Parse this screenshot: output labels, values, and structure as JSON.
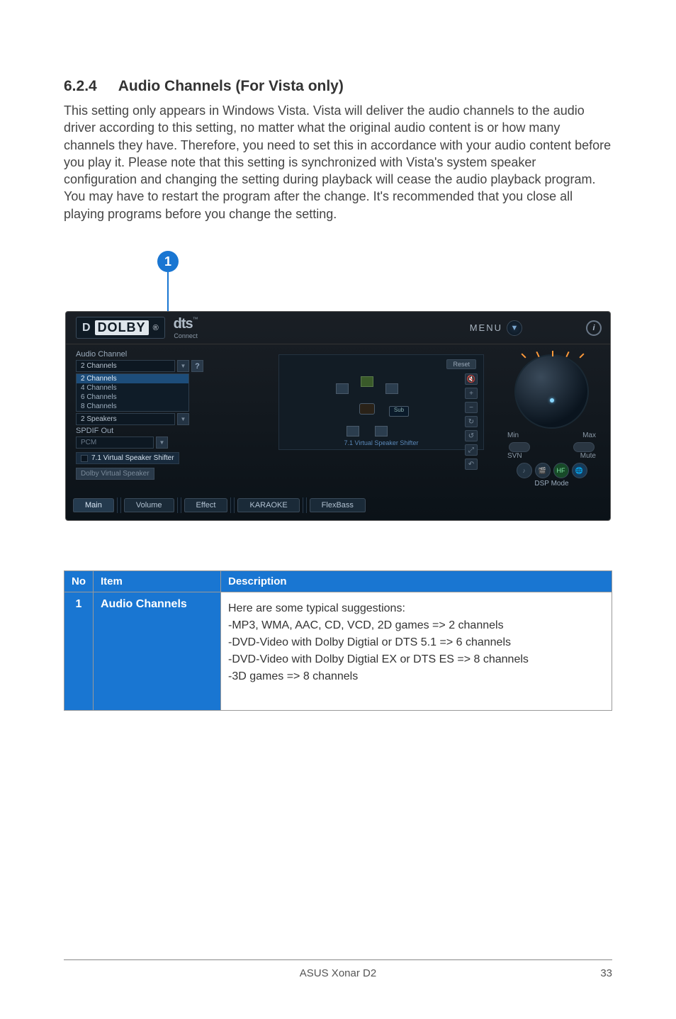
{
  "heading": {
    "number": "6.2.4",
    "title": "Audio Channels (For Vista only)"
  },
  "body": "This setting only appears in Windows Vista. Vista will deliver the audio channels to the audio driver according to this setting, no matter what the original audio content is or how many channels they have. Therefore, you need to set this in accordance with your audio content before you play it. Please note that this setting is synchronized with Vista's system speaker configuration and changing the setting during playback will cease the audio playback program. You may have to restart the program after the change. It's recommended that you close all playing programs before you change the setting.",
  "callout": {
    "number": "1"
  },
  "shot": {
    "logos": {
      "dolby_small": "D",
      "dolby_text": "DOLBY",
      "reg": "®",
      "dts": "dts",
      "dts_tm": "™",
      "connect": "Connect"
    },
    "menu": {
      "label": "MENU",
      "arrow": "▼"
    },
    "info": "i",
    "audio_channel_label": "Audio Channel",
    "audio_channel_value": "2 Channels",
    "audio_channel_options": [
      "2 Channels",
      "4 Channels",
      "6 Channels",
      "8 Channels"
    ],
    "analog_out_value": "2 Speakers",
    "spdif_label": "SPDIF Out",
    "spdif_value": "PCM",
    "vss_label": "7.1 Virtual Speaker Shifter",
    "dvs_label": "Dolby Virtual Speaker",
    "reset": "Reset",
    "sub": "Sub",
    "vss_caption": "7.1 Virtual Speaker Shifter",
    "knob": {
      "min": "Min",
      "max": "Max",
      "svn": "SVN",
      "mute": "Mute"
    },
    "dsp_mode": "DSP Mode",
    "tabs": [
      "Main",
      "Volume",
      "Effect",
      "KARAOKE",
      "FlexBass"
    ]
  },
  "table": {
    "head": {
      "no": "No",
      "item": "Item",
      "desc": "Description"
    },
    "row1": {
      "no": "1",
      "item": "Audio Channels",
      "lines": [
        "Here are some typical suggestions:",
        "-MP3, WMA, AAC, CD, VCD, 2D games => 2 channels",
        "-DVD-Video with Dolby Digtial or DTS 5.1 => 6 channels",
        "-DVD-Video with Dolby Digtial EX or DTS ES => 8 channels",
        "-3D games => 8 channels"
      ]
    }
  },
  "footer": {
    "title": "ASUS Xonar D2",
    "page": "33"
  }
}
